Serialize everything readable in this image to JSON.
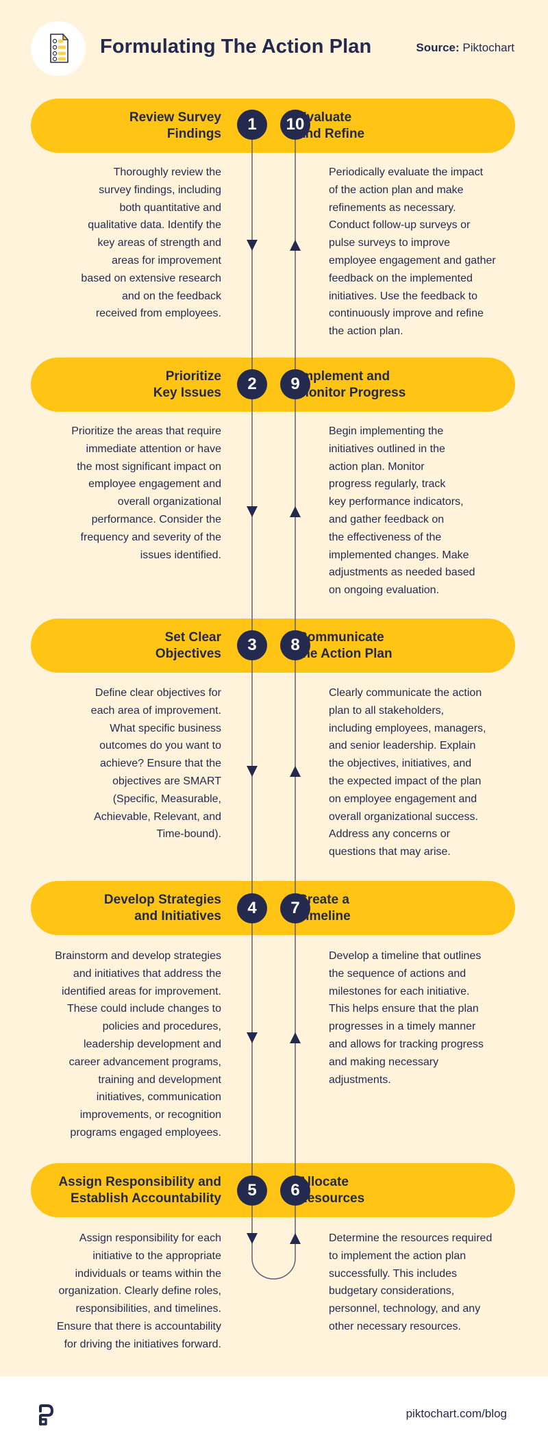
{
  "header": {
    "title": "Formulating The Action Plan",
    "source_label": "Source:",
    "source_value": "Piktochart",
    "icon": "checklist-document-icon"
  },
  "colors": {
    "background": "#FFF4DB",
    "pill": "#FFC414",
    "navy": "#232A4E",
    "line": "#5B5F73"
  },
  "rows": [
    {
      "left": {
        "number": "1",
        "title": "Review Survey\nFindings",
        "description": "Thoroughly review the\nsurvey findings, including\nboth quantitative and\nqualitative data. Identify the\nkey areas of strength and\nareas for improvement\nbased on extensive research\nand on the feedback\nreceived from employees."
      },
      "right": {
        "number": "10",
        "title": "Evaluate\nand Refine",
        "description": "Periodically evaluate the impact\nof the action plan and make\nrefinements as necessary.\nConduct follow-up surveys or\npulse surveys to improve\nemployee engagement and gather\nfeedback on the implemented\ninitiatives. Use the feedback to\ncontinuously improve and refine\nthe action plan."
      }
    },
    {
      "left": {
        "number": "2",
        "title": "Prioritize\nKey Issues",
        "description": "Prioritize the areas that require\nimmediate attention or have\nthe most significant impact on\nemployee engagement and\noverall organizational\nperformance. Consider the\nfrequency and severity of the\nissues identified."
      },
      "right": {
        "number": "9",
        "title": "Implement and\nMonitor Progress",
        "description": "Begin implementing the\ninitiatives outlined in the\naction plan. Monitor\nprogress regularly, track\nkey performance indicators,\nand gather feedback on\nthe effectiveness of the\nimplemented changes. Make\nadjustments as needed based\non ongoing evaluation."
      }
    },
    {
      "left": {
        "number": "3",
        "title": "Set Clear\nObjectives",
        "description": "Define clear objectives for\neach area of improvement.\nWhat specific business\noutcomes do you want to\nachieve? Ensure that the\nobjectives are SMART\n(Specific, Measurable,\nAchievable, Relevant, and\nTime-bound)."
      },
      "right": {
        "number": "8",
        "title": "Communicate\nthe Action Plan",
        "description": "Clearly communicate the action\nplan to all stakeholders,\nincluding employees, managers,\nand senior leadership. Explain\nthe objectives, initiatives, and\nthe expected impact of the plan\non employee engagement and\noverall organizational success.\nAddress any concerns or\nquestions that may arise."
      }
    },
    {
      "left": {
        "number": "4",
        "title": "Develop Strategies\nand Initiatives",
        "description": "Brainstorm and develop strategies\nand initiatives that address the\nidentified areas for improvement.\nThese could include changes to\npolicies and procedures,\nleadership development and\ncareer advancement programs,\ntraining and development\ninitiatives, communication\nimprovements, or recognition\nprograms engaged employees."
      },
      "right": {
        "number": "7",
        "title": "Create a\nTimeline",
        "description": "Develop a timeline that outlines\nthe sequence of actions and\nmilestones for each initiative.\nThis helps ensure that the plan\nprogresses in a timely manner\nand allows for tracking progress\nand making necessary\nadjustments."
      }
    },
    {
      "left": {
        "number": "5",
        "title": "Assign Responsibility and\nEstablish Accountability",
        "description": "Assign responsibility for each\ninitiative to the appropriate\nindividuals or teams within the\norganization. Clearly define roles,\nresponsibilities, and timelines.\nEnsure that there is accountability\nfor driving the initiatives forward."
      },
      "right": {
        "number": "6",
        "title": "Allocate\nResources",
        "description": "Determine the resources required\nto implement the action plan\nsuccessfully. This includes\nbudgetary considerations,\npersonnel, technology, and any\nother necessary resources."
      }
    }
  ],
  "footer": {
    "logo": "piktochart-logo-icon",
    "link": "piktochart.com/blog"
  }
}
